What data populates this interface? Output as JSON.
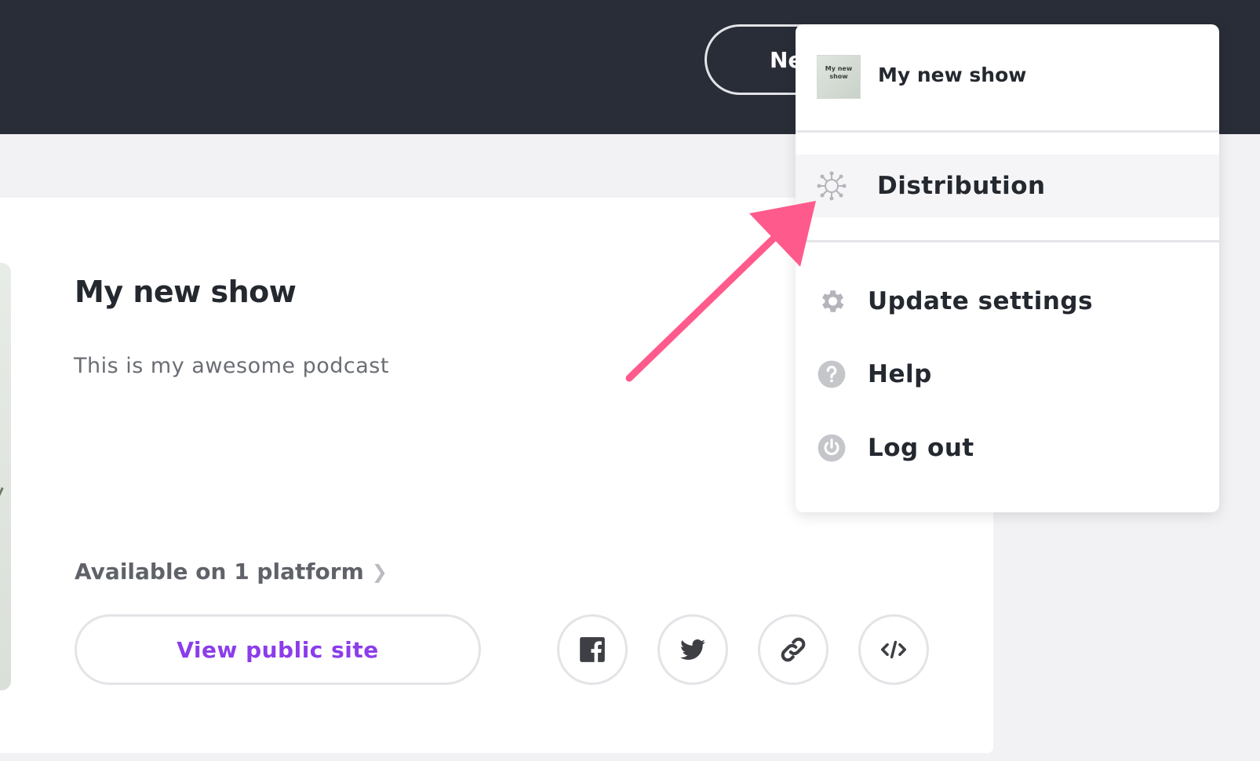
{
  "header": {
    "new_button_label": "Ne"
  },
  "show": {
    "title": "My new show",
    "description": "This is my awesome podcast",
    "platforms_text": "Available on 1 platform",
    "view_public_label": "View public site"
  },
  "share": [
    "facebook-icon",
    "twitter-icon",
    "link-icon",
    "embed-icon"
  ],
  "menu": {
    "show_name": "My new show",
    "thumb_text": "My new show",
    "items": [
      {
        "label": "Distribution",
        "icon": "distribution-icon"
      },
      {
        "label": "Update settings",
        "icon": "gear-icon"
      },
      {
        "label": "Help",
        "icon": "help-icon"
      },
      {
        "label": "Log out",
        "icon": "power-icon"
      }
    ]
  },
  "colors": {
    "topbar": "#282d37",
    "accent": "#8b3dea",
    "annotation_arrow": "#ff5a8c"
  }
}
